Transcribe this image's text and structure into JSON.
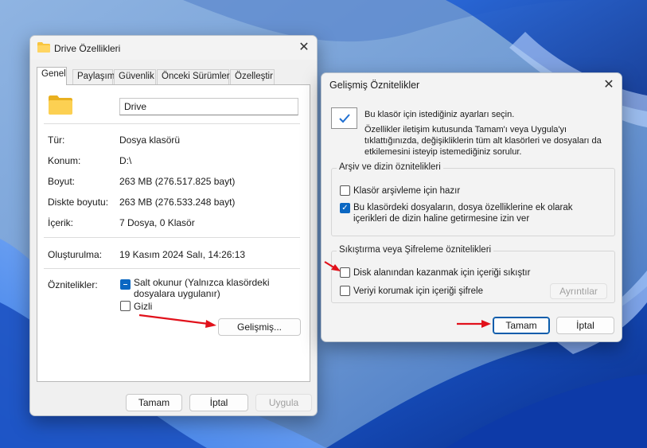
{
  "colors": {
    "accent": "#0b67c2",
    "folder": "#f8c53f",
    "arrow": "#e1111b",
    "wallpaper_base": "#7fa6d8"
  },
  "properties_dialog": {
    "title": "Drive Özellikleri",
    "icon": "folder-icon",
    "tabs": [
      "Genel",
      "Paylaşım",
      "Güvenlik",
      "Önceki Sürümler",
      "Özelleştir"
    ],
    "active_tab": "Genel",
    "folder_name": "Drive",
    "rows": [
      {
        "label": "Tür:",
        "value": "Dosya klasörü"
      },
      {
        "label": "Konum:",
        "value": "D:\\"
      },
      {
        "label": "Boyut:",
        "value": "263 MB (276.517.825 bayt)"
      },
      {
        "label": "Diskte boyutu:",
        "value": "263 MB (276.533.248 bayt)"
      },
      {
        "label": "İçerik:",
        "value": "7 Dosya, 0 Klasör"
      }
    ],
    "created": {
      "label": "Oluşturulma:",
      "value": "19 Kasım 2024 Salı, 14:26:13"
    },
    "attributes": {
      "label": "Öznitelikler:",
      "readonly_label": "Salt okunur (Yalnızca klasördeki dosyalara uygulanır)",
      "readonly_state": "mixed",
      "hidden_label": "Gizli",
      "hidden_checked": false,
      "advanced_button": "Gelişmiş..."
    },
    "buttons": {
      "ok": "Tamam",
      "cancel": "İptal",
      "apply": "Uygula"
    }
  },
  "advanced_dialog": {
    "title": "Gelişmiş Öznitelikler",
    "intro_1": "Bu klasör için istediğiniz ayarları seçin.",
    "intro_2": "Özellikler iletişim kutusunda Tamam'ı veya Uygula'yı tıklattığınızda, değişikliklerin tüm alt klasörleri ve dosyaları da etkilemesini isteyip istemediğiniz sorulur.",
    "archive_group": {
      "title": "Arşiv ve dizin öznitelikleri",
      "archive_label": "Klasör arşivleme için hazır",
      "archive_checked": false,
      "index_label": "Bu klasördeki dosyaların, dosya özelliklerine ek olarak içerikleri de dizin haline getirmesine izin ver",
      "index_checked": true
    },
    "compress_group": {
      "title": "Sıkıştırma veya Şifreleme öznitelikleri",
      "compress_label": "Disk alanından kazanmak için içeriği sıkıştır",
      "compress_checked": false,
      "encrypt_label": "Veriyi korumak için içeriği şifrele",
      "encrypt_checked": false,
      "details_button": "Ayrıntılar"
    },
    "buttons": {
      "ok": "Tamam",
      "cancel": "İptal"
    }
  }
}
